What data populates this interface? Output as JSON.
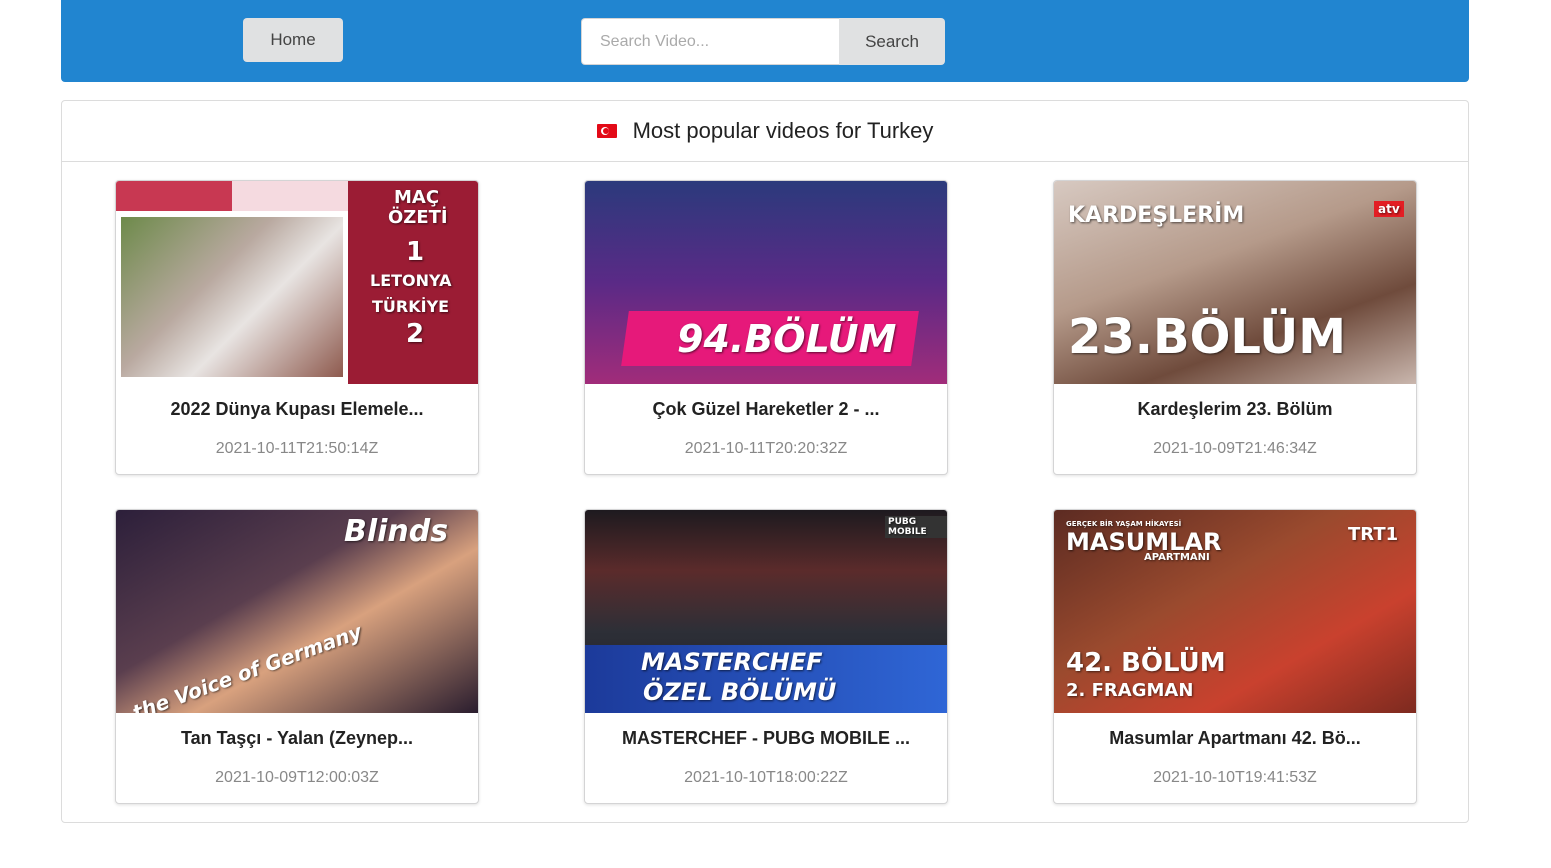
{
  "nav": {
    "home_label": "Home",
    "search_placeholder": "Search Video...",
    "search_value": "",
    "search_button": "Search"
  },
  "panel": {
    "title": "Most popular videos for Turkey",
    "flag_icon": "turkey-flag-icon"
  },
  "videos": [
    {
      "title": "2022 Dünya Kupası Elemele...",
      "date": "2021-10-11T21:50:14Z",
      "thumb_text": [
        "MAÇ",
        "ÖZETİ",
        "1",
        "LETONYA",
        "TÜRKİYE",
        "2"
      ]
    },
    {
      "title": "Çok Güzel Hareketler 2 - ...",
      "date": "2021-10-11T20:20:32Z",
      "thumb_text": [
        "94.BÖLÜM"
      ]
    },
    {
      "title": "Kardeşlerim 23. Bölüm",
      "date": "2021-10-09T21:46:34Z",
      "thumb_text": [
        "KARDEŞLERİM",
        "23.BÖLÜM",
        "atv"
      ]
    },
    {
      "title": "Tan Taşçı - Yalan (Zeynep...",
      "date": "2021-10-09T12:00:03Z",
      "thumb_text": [
        "Blinds",
        "the Voice of Germany"
      ]
    },
    {
      "title": "MASTERCHEF - PUBG MOBILE ...",
      "date": "2021-10-10T18:00:22Z",
      "thumb_text": [
        "MASTERCHEF",
        "ÖZEL BÖLÜMÜ",
        "PUBG MOBILE"
      ]
    },
    {
      "title": "Masumlar Apartmanı 42. Bö...",
      "date": "2021-10-10T19:41:53Z",
      "thumb_text": [
        "GERÇEK BİR YAŞAM HİKAYESİ",
        "MASUMLAR",
        "APARTMANI",
        "TRT1",
        "42. BÖLÜM",
        "2. FRAGMAN"
      ]
    }
  ],
  "colors": {
    "topbar": "#2185d0",
    "button": "#e0e1e2",
    "date_text": "#888888"
  }
}
